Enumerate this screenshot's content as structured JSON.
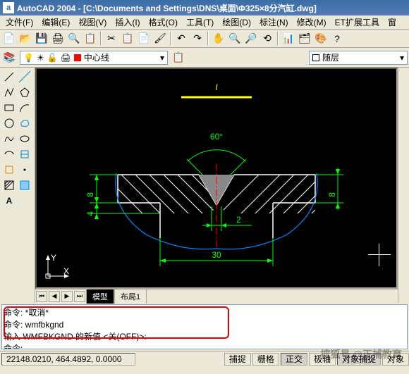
{
  "title": "AutoCAD 2004 - [C:\\Documents and Settings\\DNS\\桌面\\Φ325×8分汽缸.dwg]",
  "app_icon": "a",
  "menu": [
    "文件(F)",
    "编辑(E)",
    "视图(V)",
    "插入(I)",
    "格式(O)",
    "工具(T)",
    "绘图(D)",
    "标注(N)",
    "修改(M)",
    "ET扩展工具",
    "窗"
  ],
  "layer": {
    "current": "中心线",
    "linetype": "随层"
  },
  "tabs": {
    "model": "模型",
    "layout": "布局1"
  },
  "cmd": {
    "l1": "命令:  *取消*",
    "l2": "命令:  wmfbkgnd",
    "l3": "输入 WMFBKGND 的新值 <关(OFF)>:",
    "l4": "命令:"
  },
  "status": {
    "coord": "22148.0210, 464.4892, 0.0000",
    "buttons": [
      "捕捉",
      "栅格",
      "正交",
      "极轴",
      "对象捕捉",
      "对象"
    ]
  },
  "drawing": {
    "angle": "60°",
    "dim_left_top": "8",
    "dim_left_bot": "4",
    "dim_right": "8",
    "dim_gap": "2",
    "dim_width": "30",
    "label": "I"
  },
  "watermark": "搜狐号 @正捕教育"
}
